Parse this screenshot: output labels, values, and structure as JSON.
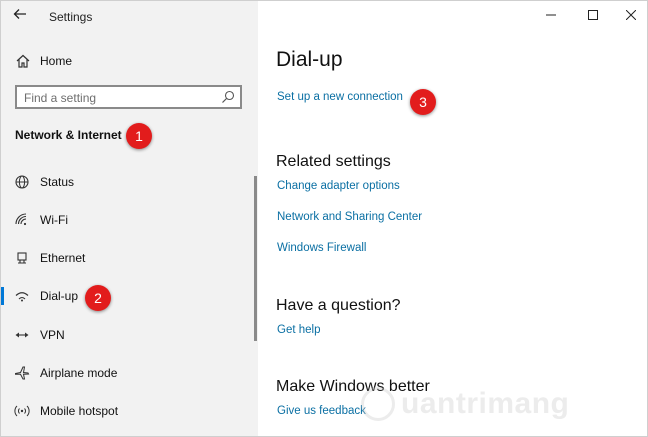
{
  "window": {
    "title": "Settings",
    "back_icon": "back-arrow-icon",
    "minimize_icon": "minimize-icon",
    "maximize_icon": "maximize-icon",
    "close_icon": "close-icon"
  },
  "sidebar": {
    "home_label": "Home",
    "search_placeholder": "Find a setting",
    "section_title": "Network & Internet",
    "items": [
      {
        "label": "Status",
        "icon": "globe-icon",
        "selected": false
      },
      {
        "label": "Wi-Fi",
        "icon": "wifi-icon",
        "selected": false
      },
      {
        "label": "Ethernet",
        "icon": "ethernet-icon",
        "selected": false
      },
      {
        "label": "Dial-up",
        "icon": "dialup-icon",
        "selected": true
      },
      {
        "label": "VPN",
        "icon": "vpn-icon",
        "selected": false
      },
      {
        "label": "Airplane mode",
        "icon": "airplane-icon",
        "selected": false
      },
      {
        "label": "Mobile hotspot",
        "icon": "hotspot-icon",
        "selected": false
      }
    ]
  },
  "main": {
    "title": "Dial-up",
    "setup_link": "Set up a new connection",
    "related_heading": "Related settings",
    "related_links": [
      "Change adapter options",
      "Network and Sharing Center",
      "Windows Firewall"
    ],
    "question_heading": "Have a question?",
    "help_link": "Get help",
    "better_heading": "Make Windows better",
    "feedback_link": "Give us feedback"
  },
  "annotations": [
    "1",
    "2",
    "3"
  ],
  "watermark": "uantrimang",
  "colors": {
    "accent": "#0078d7",
    "link": "#0a6fa3",
    "badge": "#e21c1c",
    "sidebar_bg": "#f2f2f2"
  }
}
